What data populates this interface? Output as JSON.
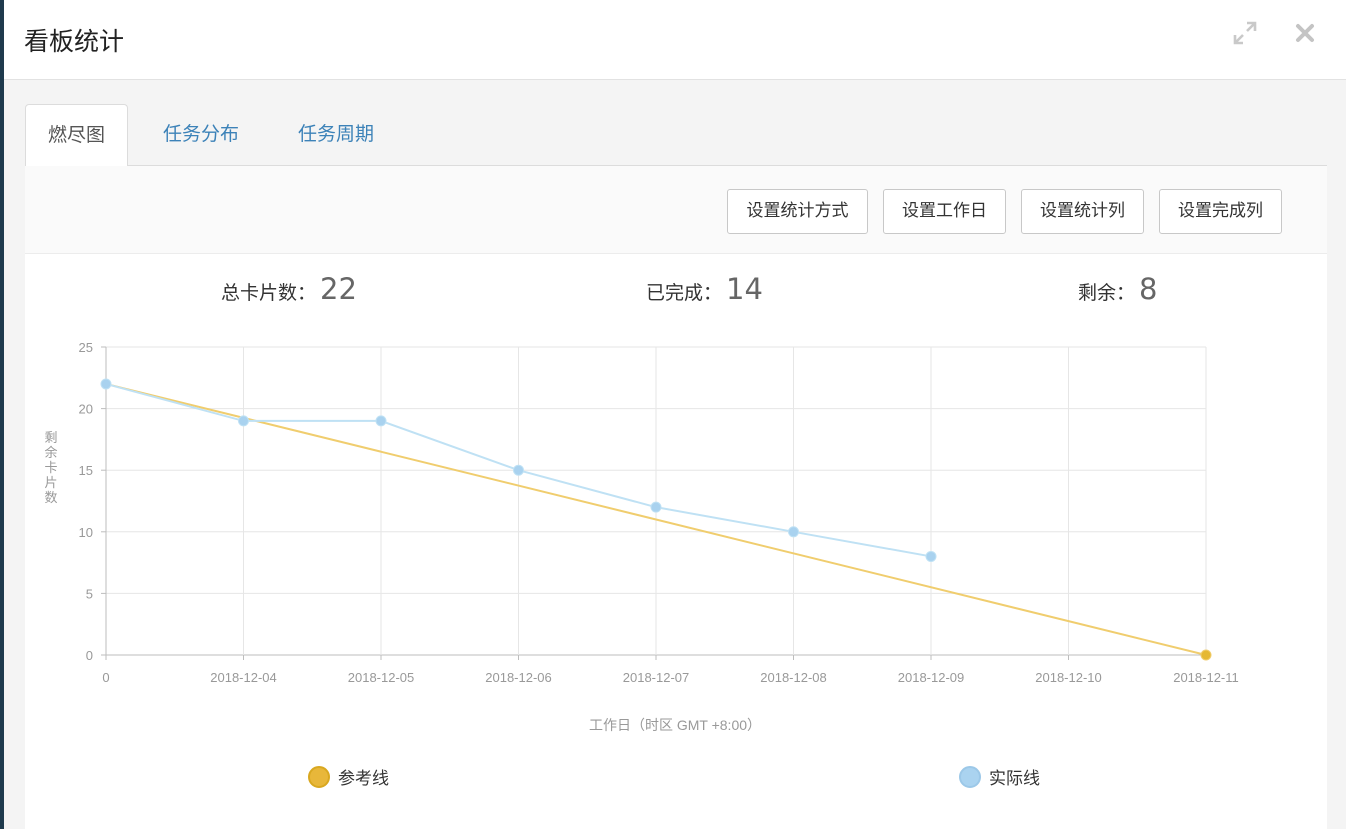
{
  "modal": {
    "title": "看板统计",
    "expand_icon": "expand-icon",
    "close_icon": "close-icon"
  },
  "tabs": [
    {
      "label": "燃尽图",
      "active": true
    },
    {
      "label": "任务分布",
      "active": false
    },
    {
      "label": "任务周期",
      "active": false
    }
  ],
  "toolbar": {
    "buttons": [
      "设置统计方式",
      "设置工作日",
      "设置统计列",
      "设置完成列"
    ]
  },
  "stats": {
    "total_label": "总卡片数：",
    "total_value": "22",
    "done_label": "已完成：",
    "done_value": "14",
    "remain_label": "剩余：",
    "remain_value": "8"
  },
  "chart_data": {
    "type": "line",
    "ylabel": "剩余卡片数",
    "xlabel": "工作日（时区 GMT +8:00）",
    "categories": [
      "0",
      "2018-12-04",
      "2018-12-05",
      "2018-12-06",
      "2018-12-07",
      "2018-12-08",
      "2018-12-09",
      "2018-12-10",
      "2018-12-11"
    ],
    "ylim": [
      0,
      25
    ],
    "yticks": [
      0,
      5,
      10,
      15,
      20,
      25
    ],
    "grid": true,
    "legend_position": "bottom",
    "series": [
      {
        "name": "参考线",
        "color": "#f0cd6e",
        "marker_color": "#e5b832",
        "values": [
          22,
          null,
          null,
          null,
          null,
          null,
          null,
          null,
          0
        ],
        "markers": [
          false,
          false,
          false,
          false,
          false,
          false,
          false,
          false,
          true
        ]
      },
      {
        "name": "实际线",
        "color": "#bfe1f4",
        "marker_color": "#a9d2ef",
        "values": [
          22,
          19,
          19,
          15,
          12,
          10,
          8
        ],
        "markers": [
          true,
          true,
          true,
          true,
          true,
          true,
          true
        ]
      }
    ]
  },
  "legend": [
    {
      "label": "参考线",
      "color": "#e8b73a"
    },
    {
      "label": "实际线",
      "color": "#aad3f0"
    }
  ]
}
